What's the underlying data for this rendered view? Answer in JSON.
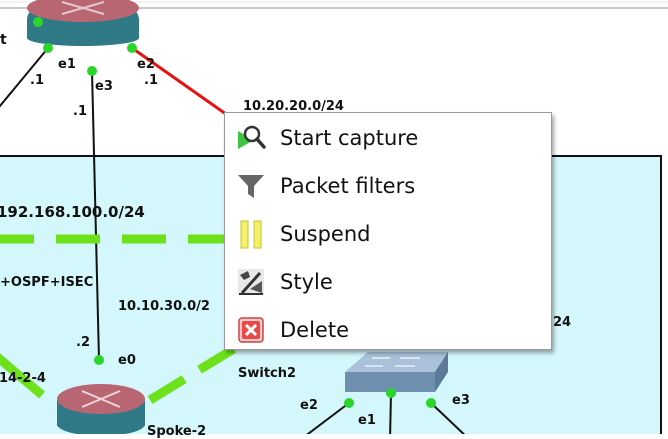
{
  "labels": {
    "node_top_partial": "t",
    "iface_top_e1": "e1",
    "iface_top_e3": "e3",
    "iface_top_e2": "e2",
    "addr_dot1_left": ".1",
    "addr_dot1_right": ".1",
    "addr_dot1_e3": ".1",
    "net_10_20_20": "10.20.20.0/24",
    "net_192_168_100": "192.168.100.0/24",
    "ospf_isec": "+OSPF+ISEC",
    "net_10_10_30": "10.10.30.0/2",
    "net_right_24": "24",
    "addr_dot2": ".2",
    "iface_spoke_e0": "e0",
    "switch2": "Switch2",
    "left_partial": ".14-2-4",
    "iface_sw_e2": "e2",
    "iface_sw_e1": "e1",
    "iface_sw_e3": "e3",
    "spoke2": "Spoke-2"
  },
  "context_menu": {
    "items": [
      {
        "label": "Start capture",
        "icon": "start-capture-icon"
      },
      {
        "label": "Packet filters",
        "icon": "packet-filter-icon"
      },
      {
        "label": "Suspend",
        "icon": "suspend-icon"
      },
      {
        "label": "Style",
        "icon": "style-icon"
      },
      {
        "label": "Delete",
        "icon": "delete-icon"
      }
    ]
  },
  "colors": {
    "area_fill": "#d4f7fb",
    "area_border": "#111111",
    "link_red": "#e81010",
    "link_green": "#6de21b",
    "port_green": "#2bd62b",
    "router_body": "#2f7a86",
    "router_top": "#b86671",
    "switch_body": "#7f9db8"
  }
}
